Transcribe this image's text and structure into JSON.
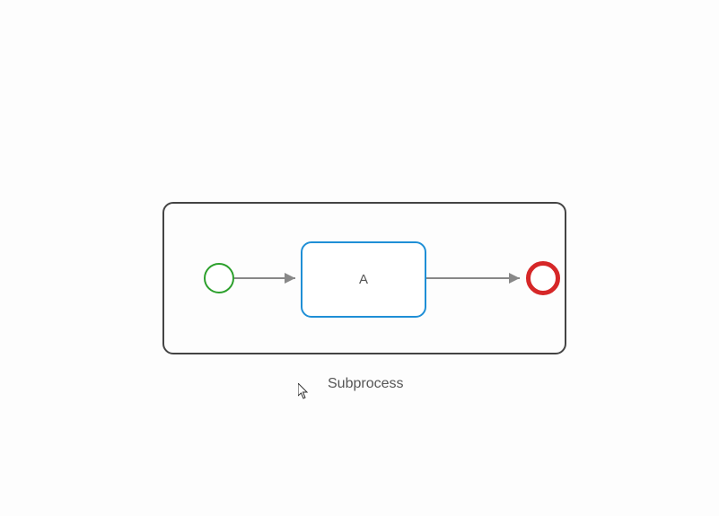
{
  "diagram": {
    "container_label": "Subprocess",
    "task_label": "A",
    "elements": {
      "start_event": {
        "type": "start-event",
        "color": "#2ca02c"
      },
      "task": {
        "type": "task",
        "label": "A",
        "color": "#1f8fd6"
      },
      "end_event": {
        "type": "end-event",
        "color": "#d62728"
      }
    },
    "flows": [
      {
        "from": "start_event",
        "to": "task"
      },
      {
        "from": "task",
        "to": "end_event"
      }
    ]
  }
}
